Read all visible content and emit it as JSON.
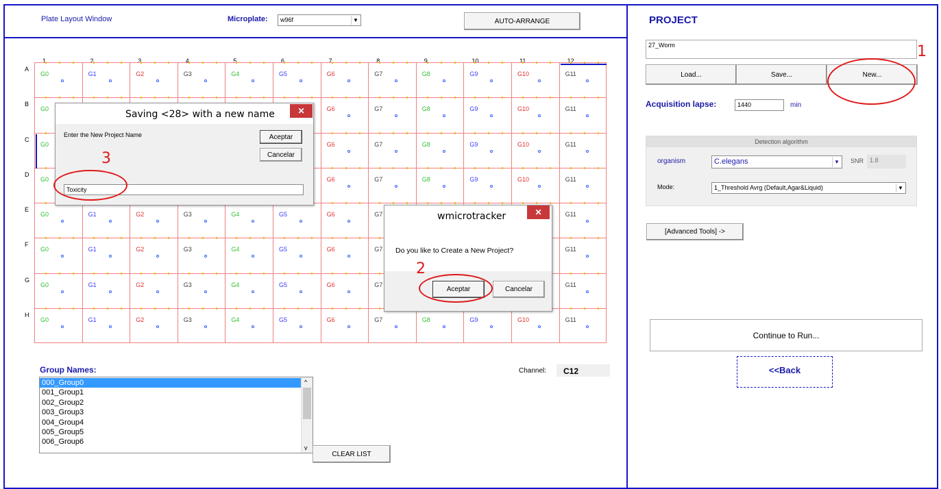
{
  "plate_window": {
    "title": "Plate Layout Window",
    "microplate_label": "Microplate:",
    "microplate_value": "w96f",
    "auto_arrange_label": "AUTO-ARRANGE"
  },
  "grid": {
    "columns": [
      "1",
      "2",
      "3",
      "4",
      "5",
      "6",
      "7",
      "8",
      "9",
      "10",
      "11",
      "12"
    ],
    "rows": [
      "A",
      "B",
      "C",
      "D",
      "E",
      "F",
      "G",
      "H"
    ],
    "group_labels": [
      "G0",
      "G1",
      "G2",
      "G3",
      "G4",
      "G5",
      "G6",
      "G7",
      "G8",
      "G9",
      "G10",
      "G11"
    ],
    "group_colors": [
      "#2fbf2f",
      "#3a3aff",
      "#e03030",
      "#404040",
      "#2fbf2f",
      "#3a3aff",
      "#e03030",
      "#404040",
      "#2fbf2f",
      "#3a3aff",
      "#e03030",
      "#404040"
    ]
  },
  "group_names": {
    "label": "Group Names:",
    "items": [
      "000_Group0",
      "001_Group1",
      "002_Group2",
      "003_Group3",
      "004_Group4",
      "005_Group5",
      "006_Group6"
    ],
    "selected_index": 0,
    "clear_list_label": "CLEAR LIST"
  },
  "channel": {
    "label": "Channel:",
    "value": "C12"
  },
  "save_dialog": {
    "title": "Saving <28> with a new name",
    "prompt": "Enter the New Project Name",
    "accept_label": "Aceptar",
    "cancel_label": "Cancelar",
    "input_value": "Toxicity"
  },
  "confirm_dialog": {
    "title": "wmicrotracker",
    "message": "Do you like to Create a New Project?",
    "accept_label": "Aceptar",
    "cancel_label": "Cancelar"
  },
  "project": {
    "title": "PROJECT",
    "name_value": "27_Worm",
    "load_label": "Load...",
    "save_label": "Save...",
    "new_label": "New...",
    "acq_label": "Acquisition lapse:",
    "acq_value": "1440",
    "acq_unit": "min",
    "detection_title": "Detection algorithm",
    "organism_label": "organism",
    "organism_value": "C.elegans",
    "snr_label": "SNR",
    "snr_value": "1.8",
    "mode_label": "Mode:",
    "mode_value": "1_Threshold Avrg (Default,Agar&Liquid)",
    "advanced_label": "[Advanced Tools]  ->",
    "continue_label": "Continue to Run...",
    "back_label": "<<Back"
  },
  "annotations": {
    "n1": "1",
    "n2": "2",
    "n3": "3"
  },
  "colors": {
    "frame_blue": "#1414c8",
    "title_blue": "#1a1aa8",
    "annotation_red": "#e01818",
    "grid_red": "#f08080"
  }
}
